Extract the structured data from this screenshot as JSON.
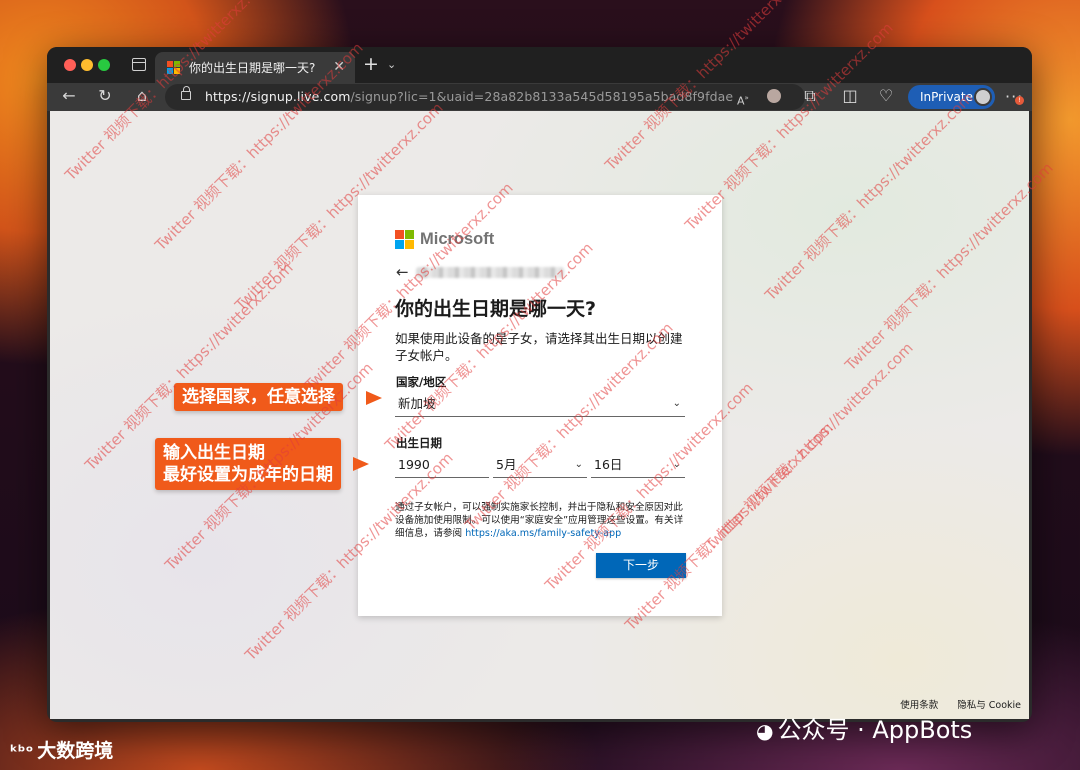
{
  "browser": {
    "tab_title": "你的出生日期是哪一天?",
    "url_host": "https://signup.live.com",
    "url_path": "/signup?lic=1&uaid=28a82b8133a545d58195a5bad8f9fdae",
    "inprivate_label": "InPrivate",
    "colors": {
      "ms_red": "#f25022",
      "ms_green": "#7fba00",
      "ms_blue": "#00a4ef",
      "ms_yellow": "#ffb900"
    }
  },
  "card": {
    "brand": "Microsoft",
    "title": "你的出生日期是哪一天?",
    "description": "如果使用此设备的是子女，请选择其出生日期以创建子女帐户。",
    "country_label": "国家/地区",
    "country_value": "新加坡",
    "birthdate_label": "出生日期",
    "year_value": "1990",
    "month_value": "5月",
    "day_value": "16日",
    "fine_print": "通过子女帐户，可以强制实施家长控制，并出于隐私和安全原因对此设备施加使用限制。可以使用“家庭安全”应用管理这些设置。有关详细信息，请参阅",
    "fine_print_link": "https://aka.ms/family-safety-app",
    "next_button": "下一步"
  },
  "footer": {
    "terms": "使用条款",
    "privacy": "隐私与 Cookie"
  },
  "annotations": {
    "country_callout": "选择国家，任意选择",
    "birthdate_callout_line1": "输入出生日期",
    "birthdate_callout_line2": "最好设置为成年的日期"
  },
  "watermark": {
    "diagonal_text": "Twitter 视频下载：https://twitterxz.com",
    "bottom_left": "大数跨境",
    "bottom_right": "公众号 · AppBots"
  }
}
